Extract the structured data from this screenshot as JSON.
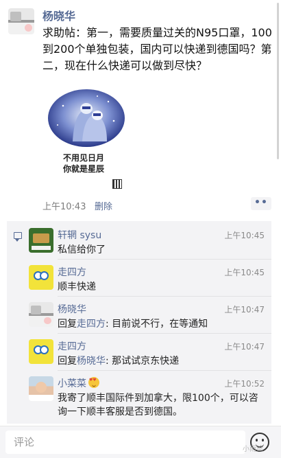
{
  "post": {
    "author": "杨晓华",
    "text": "求助帖：第一，需要质量过关的N95口罩，100到200个单独包装，国内可以快递到德国吗？第二，现在什么快递可以做到尽快？",
    "image_caption_line1": "不用见日月",
    "image_caption_line2": "你就是星辰",
    "time": "上午10:43",
    "delete_label": "删除",
    "more_label": "••"
  },
  "comments": [
    {
      "author": "轩辋 sysu",
      "time": "上午10:45",
      "text": "私信给你了",
      "avatar_icon": "bookshelf-avatar"
    },
    {
      "author": "走四方",
      "time": "上午10:45",
      "text": "顺丰快递",
      "avatar_icon": "spongebob-avatar"
    },
    {
      "author": "杨晓华",
      "time": "上午10:47",
      "reply_prefix": "回复",
      "reply_to": "走四方",
      "text": ": 目前说不行，在等通知",
      "avatar_icon": "photo-avatar"
    },
    {
      "author": "走四方",
      "time": "上午10:47",
      "reply_prefix": "回复",
      "reply_to": "杨晓华",
      "text": ": 那试试京东快递",
      "avatar_icon": "spongebob-avatar"
    },
    {
      "author": "小菜菜",
      "time": "上午10:52",
      "text": "我寄了顺丰国际件到加拿大，限100个，可以咨询一下顺丰客服是否到德国。",
      "avatar_icon": "child-photo-avatar",
      "name_emoji": "heart-eyes-emoji"
    }
  ],
  "input": {
    "placeholder": "评论"
  },
  "watermark": "小雨论",
  "colors": {
    "link": "#576b95",
    "comment_bg": "#f3f3f5"
  }
}
